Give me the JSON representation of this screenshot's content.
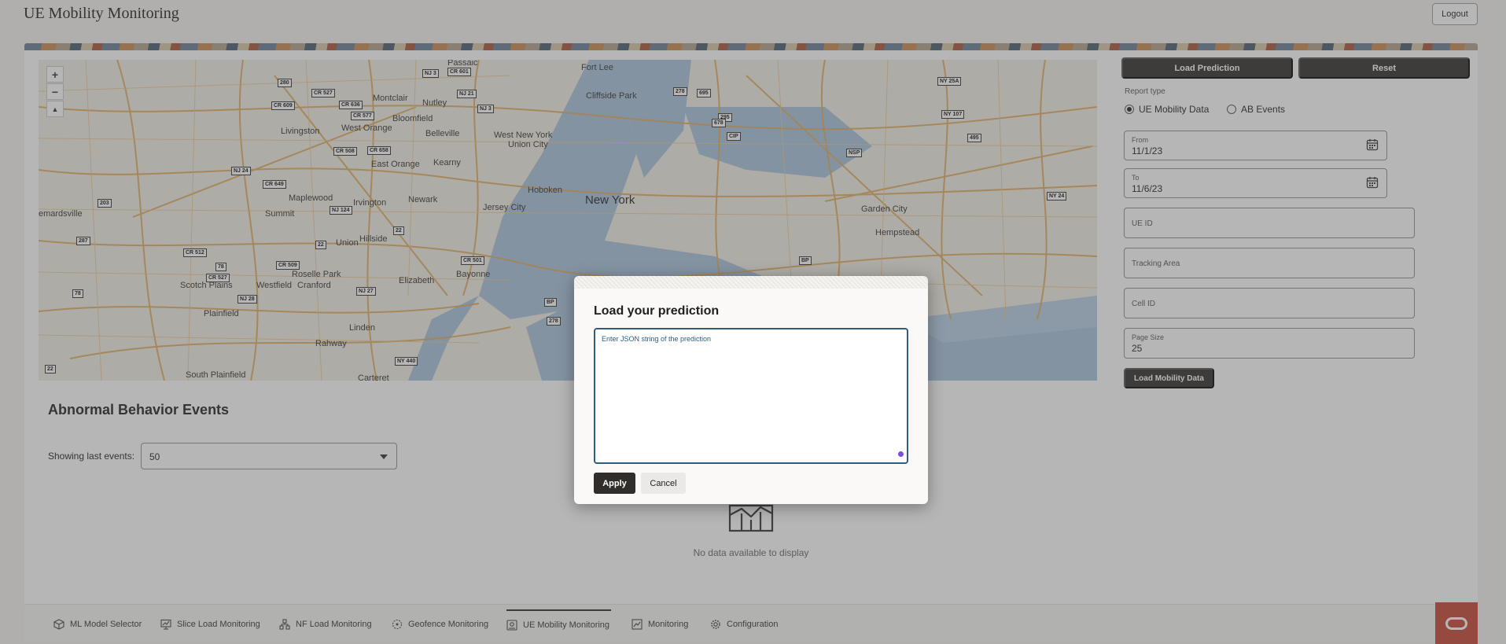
{
  "header": {
    "title": "UE Mobility Monitoring",
    "logout_label": "Logout"
  },
  "map": {
    "zoom_in": "+",
    "zoom_out": "−",
    "reset_north": "▲",
    "places": [
      "Fort Lee",
      "Cliffside Park",
      "Montclair",
      "Nutley",
      "Livingston",
      "West Orange",
      "Bloomfield",
      "Belleville",
      "West New York",
      "Union City",
      "East Orange",
      "Kearny",
      "Hoboken",
      "New York",
      "Jersey City",
      "Maplewood",
      "Irvington",
      "Newark",
      "Summit",
      "Union",
      "Hillside",
      "Garden City",
      "Hempstead",
      "Roselle Park",
      "Elizabeth",
      "Bayonne",
      "Scotch Plains",
      "Westfield",
      "Cranford",
      "Plainfield",
      "Linden",
      "Rahway",
      "South Plainfield",
      "Carteret",
      "emardsville",
      "Passaic"
    ],
    "shields": [
      "NJ 3",
      "CR 601",
      "280",
      "CR 527",
      "CR 636",
      "CR 577",
      "NJ 21",
      "NJ 3",
      "CR 609",
      "CR 508",
      "CR 658",
      "NJ 24",
      "CR 649",
      "NJ 124",
      "203",
      "287",
      "CR 512",
      "CR 527",
      "CR 509",
      "NJ 28",
      "NJ 27",
      "CR 501",
      "278",
      "440",
      "NY 25A",
      "NY 107",
      "495",
      "NY 24",
      "278",
      "695",
      "295",
      "678",
      "CIP",
      "NSP",
      "BP",
      "BP",
      "22",
      "22",
      "78",
      "78",
      "NY 440",
      "22"
    ]
  },
  "controls": {
    "load_prediction": "Load Prediction",
    "reset": "Reset",
    "report_type_label": "Report type",
    "report_types": [
      "UE Mobility Data",
      "AB Events"
    ],
    "from_label": "From",
    "from_value": "11/1/23",
    "to_label": "To",
    "to_value": "11/6/23",
    "ue_id_placeholder": "UE ID",
    "tracking_area_placeholder": "Tracking Area",
    "cell_id_placeholder": "Cell ID",
    "page_size_label": "Page Size",
    "page_size_value": "25",
    "load_mobility_button": "Load Mobility Data"
  },
  "events": {
    "title": "Abnormal Behavior Events",
    "showing_label": "Showing last events:",
    "showing_value": "50",
    "no_data": "No data available to display"
  },
  "tabs": [
    {
      "label": "ML Model Selector",
      "icon": "cube-icon"
    },
    {
      "label": "Slice Load Monitoring",
      "icon": "monitor-chart-icon"
    },
    {
      "label": "NF Load Monitoring",
      "icon": "network-icon"
    },
    {
      "label": "Geofence Monitoring",
      "icon": "geofence-icon"
    },
    {
      "label": "UE Mobility Monitoring",
      "icon": "mobility-icon",
      "active": true
    },
    {
      "label": "Monitoring",
      "icon": "chart-icon"
    },
    {
      "label": "Configuration",
      "icon": "gear-icon"
    }
  ],
  "dialog": {
    "title": "Load your prediction",
    "placeholder": "Enter JSON string of the prediction",
    "apply": "Apply",
    "cancel": "Cancel"
  },
  "colors": {
    "dark_button": "#312d2a",
    "textarea_border": "#2f5d7c",
    "brand_red": "#c74634",
    "road": "#e0a95a",
    "water": "#a9c3dc"
  }
}
